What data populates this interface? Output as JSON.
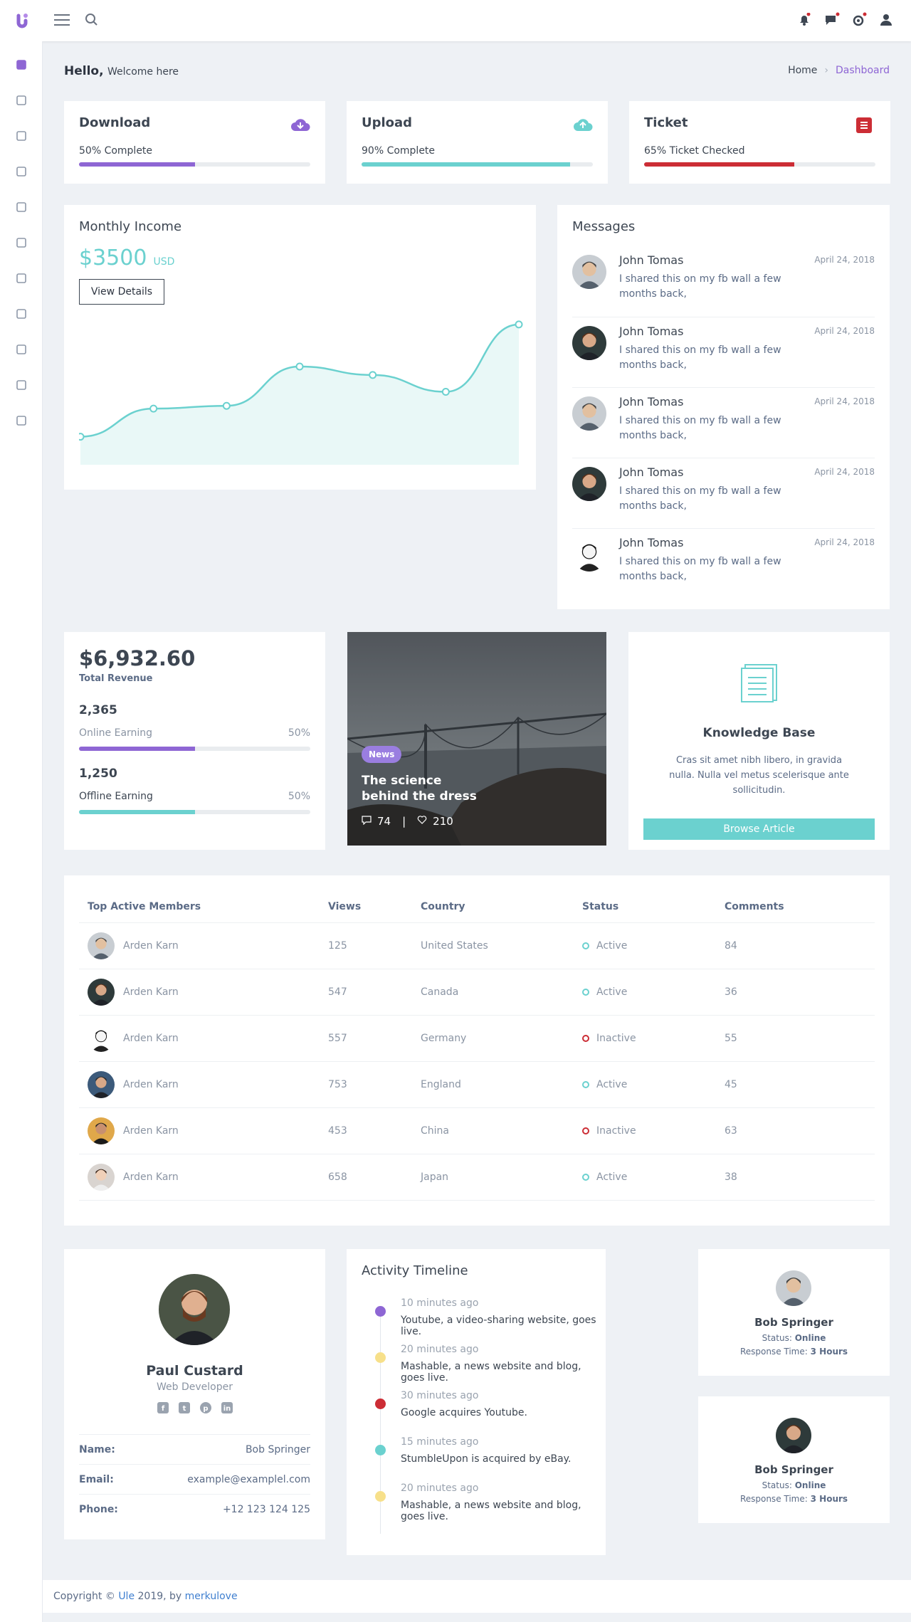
{
  "header": {
    "logo": "u-logo-icon",
    "menu_icon": "menu-icon",
    "search_icon": "search-icon",
    "icons": [
      "bell-icon",
      "chat-icon",
      "settings-icon",
      "user-icon"
    ]
  },
  "sidebar": {
    "items": [
      "dashboard-icon",
      "chart-icon",
      "mail-icon",
      "calendar-icon",
      "apps-icon",
      "diamond-icon",
      "layout-icon",
      "form-icon",
      "map-icon",
      "widget-icon",
      "edit-icon"
    ]
  },
  "page": {
    "hello": "Hello,",
    "welcome": "Welcome here",
    "breadcrumb": {
      "home": "Home",
      "current": "Dashboard"
    }
  },
  "stats": [
    {
      "title": "Download",
      "label": "50% Complete",
      "progress": 0.5,
      "color": "#8e66d4",
      "icon": "cloud-download-icon"
    },
    {
      "title": "Upload",
      "label": "90% Complete",
      "progress": 0.9,
      "color": "#6bd1cf",
      "icon": "cloud-upload-icon"
    },
    {
      "title": "Ticket",
      "label": "65% Ticket Checked",
      "progress": 0.65,
      "color": "#cc2d35",
      "icon": "ticket-icon"
    }
  ],
  "income": {
    "title": "Monthly Income",
    "amount": "$3500",
    "unit": "USD",
    "button": "View Details"
  },
  "chart_data": {
    "type": "area",
    "x": [
      1,
      2,
      3,
      4,
      5,
      6,
      7
    ],
    "values": [
      1,
      2,
      2.1,
      3.5,
      3.2,
      2.6,
      5
    ],
    "color": "#6bd1cf",
    "ylim": [
      0,
      5.2
    ]
  },
  "messages": {
    "title": "Messages",
    "items": [
      {
        "name": "John Tomas",
        "date": "April 24, 2018",
        "text": "I shared this on my fb wall a few months back,",
        "avatar": "a"
      },
      {
        "name": "John Tomas",
        "date": "April 24, 2018",
        "text": "I shared this on my fb wall a few months back,",
        "avatar": "b"
      },
      {
        "name": "John Tomas",
        "date": "April 24, 2018",
        "text": "I shared this on my fb wall a few months back,",
        "avatar": "a"
      },
      {
        "name": "John Tomas",
        "date": "April 24, 2018",
        "text": "I shared this on my fb wall a few months back,",
        "avatar": "b"
      },
      {
        "name": "John Tomas",
        "date": "April 24, 2018",
        "text": "I shared this on my fb wall a few months back,",
        "avatar": "c"
      }
    ]
  },
  "revenue": {
    "amount": "$6,932.60",
    "label": "Total Revenue",
    "rows": [
      {
        "value": "2,365",
        "label": "Online Earning",
        "pct": "50%",
        "progress": 0.5,
        "color": "#8e66d4"
      },
      {
        "value": "1,250",
        "label": "Offline Earning",
        "pct": "50%",
        "progress": 0.5,
        "color": "#6bd1cf"
      }
    ]
  },
  "news": {
    "badge": "News",
    "title": "The science behind the dress",
    "comments": "74",
    "likes": "210",
    "separator": "|"
  },
  "kb": {
    "title": "Knowledge Base",
    "text": "Cras sit amet nibh libero, in gravida nulla. Nulla vel metus scelerisque ante sollicitudin.",
    "button": "Browse Article"
  },
  "members": {
    "headers": [
      "Top Active Members",
      "Views",
      "Country",
      "Status",
      "Comments"
    ],
    "rows": [
      {
        "name": "Arden Karn",
        "views": "125",
        "country": "United States",
        "status": "Active",
        "comments": "84",
        "avatar": "a"
      },
      {
        "name": "Arden Karn",
        "views": "547",
        "country": "Canada",
        "status": "Active",
        "comments": "36",
        "avatar": "b"
      },
      {
        "name": "Arden Karn",
        "views": "557",
        "country": "Germany",
        "status": "Inactive",
        "comments": "55",
        "avatar": "c"
      },
      {
        "name": "Arden Karn",
        "views": "753",
        "country": "England",
        "status": "Active",
        "comments": "45",
        "avatar": "d"
      },
      {
        "name": "Arden Karn",
        "views": "453",
        "country": "China",
        "status": "Inactive",
        "comments": "63",
        "avatar": "e"
      },
      {
        "name": "Arden Karn",
        "views": "658",
        "country": "Japan",
        "status": "Active",
        "comments": "38",
        "avatar": "f"
      }
    ]
  },
  "profile": {
    "name": "Paul Custard",
    "role": "Web Developer",
    "socials": [
      "facebook-icon",
      "twitter-icon",
      "pinterest-icon",
      "linkedin-icon"
    ],
    "fields": [
      {
        "label": "Name:",
        "value": "Bob Springer"
      },
      {
        "label": "Email:",
        "value": "example@examplel.com"
      },
      {
        "label": "Phone:",
        "value": "+12 123 124 125"
      }
    ]
  },
  "timeline": {
    "title": "Activity Timeline",
    "items": [
      {
        "time": "10 minutes ago",
        "text": "Youtube, a video-sharing website, goes live.",
        "color": "#8e66d4"
      },
      {
        "time": "20 minutes ago",
        "text": "Mashable, a news website and blog, goes live.",
        "color": "#f7e08a"
      },
      {
        "time": "30 minutes ago",
        "text": "Google acquires Youtube.",
        "color": "#cc2d35"
      },
      {
        "time": "15 minutes ago",
        "text": "StumbleUpon is acquired by eBay.",
        "color": "#6bd1cf"
      },
      {
        "time": "20 minutes ago",
        "text": "Mashable, a news website and blog, goes live.",
        "color": "#f7e08a"
      }
    ]
  },
  "contacts": [
    {
      "name": "Bob Springer",
      "status_label": "Status:",
      "status": "Online",
      "response_label": "Response Time:",
      "response": "3 Hours",
      "avatar": "a"
    },
    {
      "name": "Bob Springer",
      "status_label": "Status:",
      "status": "Online",
      "response_label": "Response Time:",
      "response": "3 Hours",
      "avatar": "b"
    }
  ],
  "footer": {
    "prefix": "Copyright ©",
    "brand": "Ule",
    "middle": "2019, by",
    "author": "merkulove"
  }
}
